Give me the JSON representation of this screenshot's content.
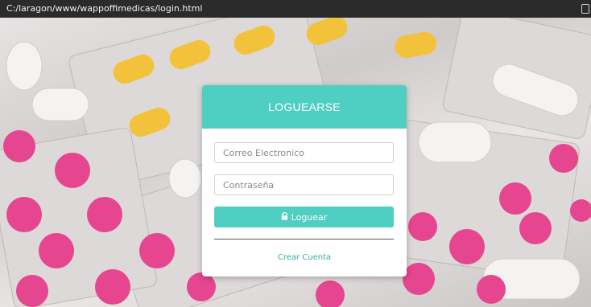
{
  "window": {
    "path": "C:/laragon/www/wappoffimedicas/login.html"
  },
  "login": {
    "title": "LOGUEARSE",
    "email_placeholder": "Correo Electronico",
    "password_placeholder": "Contraseña",
    "submit_label": "Loguear",
    "submit_icon": "lock-icon",
    "create_account_label": "Crear Cuenta"
  },
  "theme": {
    "accent": "#4fcfc1",
    "pill_yellow": "#f2c23a",
    "pill_pink": "#e6458f"
  }
}
